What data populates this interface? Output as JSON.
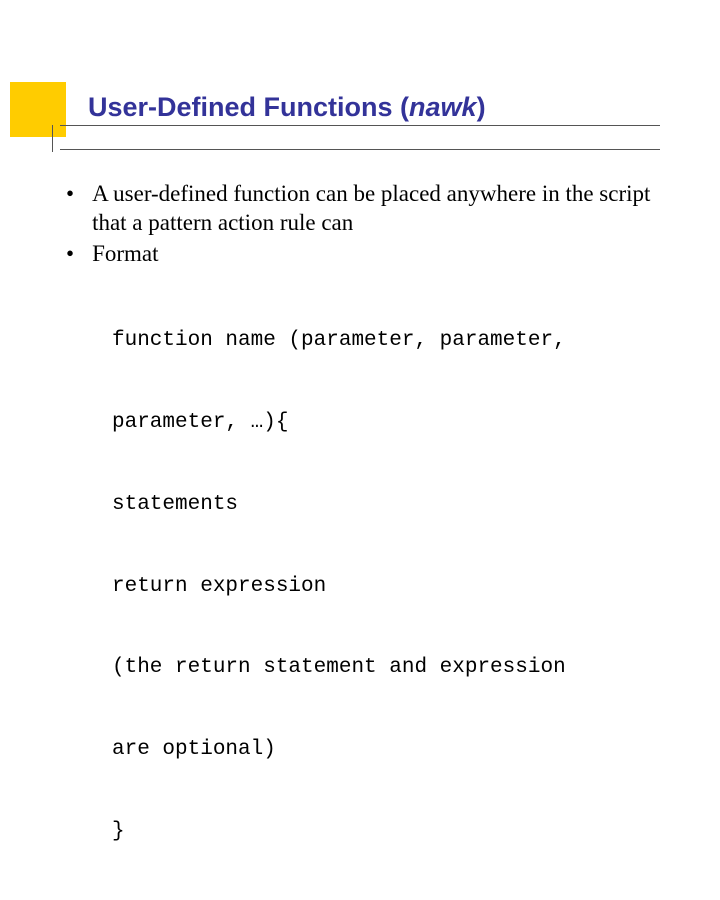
{
  "title": {
    "prefix": "User-Defined Functions (",
    "italic": "nawk",
    "suffix": ")"
  },
  "bullets": [
    "A user-defined function can be placed anywhere in the script that a pattern action rule can",
    "Format"
  ],
  "code_lines": [
    "function name (parameter, parameter,",
    "parameter, …){",
    "statements",
    "return expression",
    "(the return statement and expression",
    "are optional)",
    "}"
  ]
}
